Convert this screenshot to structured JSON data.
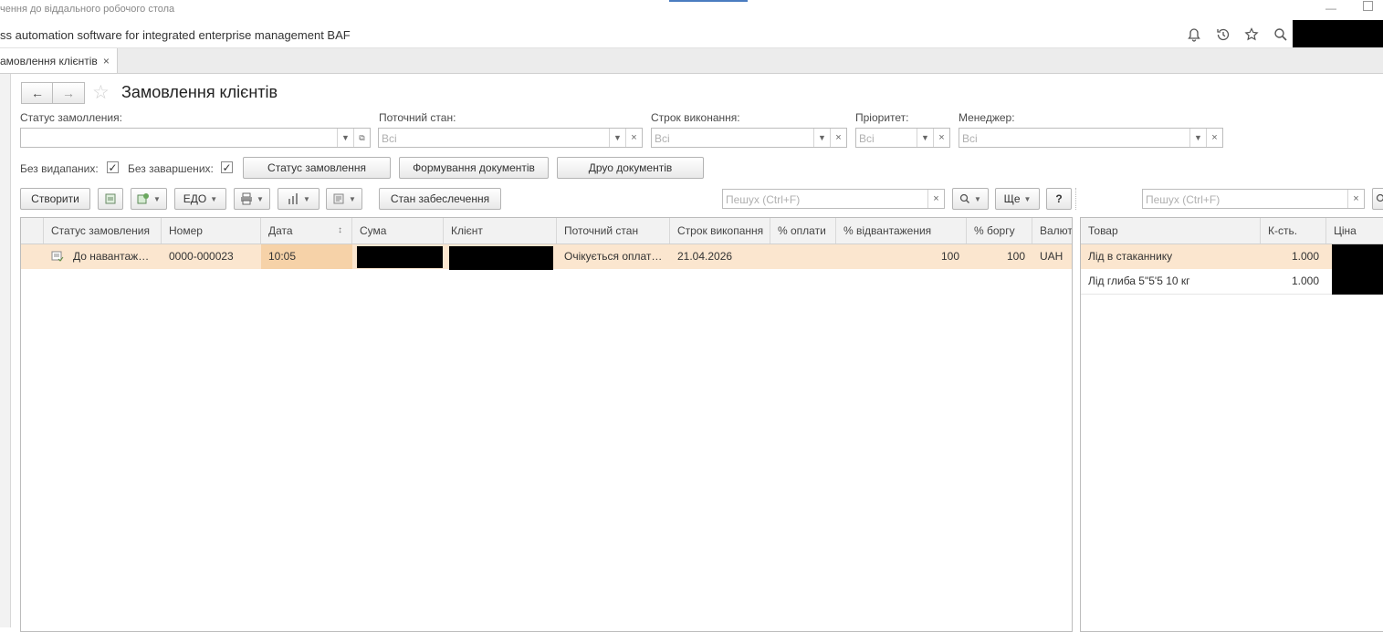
{
  "window": {
    "title": "чення до віддального робочого стола"
  },
  "app": {
    "title": "ss automation software for integrated enterprise management BAF"
  },
  "icons": {
    "bell": "bell-icon",
    "history": "history-icon",
    "favorites": "star-icon",
    "search": "search-icon"
  },
  "tab": {
    "label": "амовлення клієнтів",
    "close": "×"
  },
  "page": {
    "title": "Замовлення клієнтів",
    "back": "←",
    "forward": "→"
  },
  "filters": {
    "status_label": "Статус замолления:",
    "state_label": "Поточний стан:",
    "state_value": "Всі",
    "deadline_label": "Строк виконання:",
    "deadline_value": "Всі",
    "priority_label": "Пріоритет:",
    "priority_value": "Всі",
    "manager_label": "Менеджер:",
    "manager_value": "Всі",
    "no_issued_label": "Без видапаних:",
    "no_completed_label": "Без заваршених:",
    "check_mark": "✓",
    "btn_order_status": "Статус замовлення",
    "btn_form_docs": "Формування документів",
    "btn_print_docs": "Друо документів"
  },
  "toolbar": {
    "create": "Створити",
    "edo": "ЕДО",
    "provision": "Стан забеслечення",
    "search_placeholder": "Пешух (Ctrl+F)",
    "more": "Ще",
    "help": "?",
    "clear": "×",
    "caret": "▾"
  },
  "orders": {
    "columns": [
      "Статус замовления",
      "Номер",
      "Дата",
      "Сума",
      "Клієнт",
      "Поточний стан",
      "Строк викопання",
      "% оплати",
      "% відвантажения",
      "% боргу",
      "Валют"
    ],
    "rows": [
      {
        "status": "До навантаже…",
        "number": "0000-000023",
        "date": "10:05",
        "amount": "",
        "client": "",
        "state": "Очікується оплат…",
        "deadline": "21.04.2026",
        "paid": "",
        "shipped": "100",
        "debt": "100",
        "currency": "UAH"
      }
    ]
  },
  "goods": {
    "search_placeholder": "Пешух (Ctrl+F)",
    "columns": [
      "Товар",
      "К-сть.",
      "Ціна"
    ],
    "rows": [
      {
        "name": "Лід в стаканнику",
        "qty": "1.000"
      },
      {
        "name": "Лід глиба 5\"5'5 10 кг",
        "qty": "1.000"
      }
    ]
  },
  "colors": {
    "selected_row": "#fbe6cf",
    "selected_cell": "#f6d2a8",
    "header_bg": "#f2f2f2",
    "accent": "#4a7cc0"
  }
}
